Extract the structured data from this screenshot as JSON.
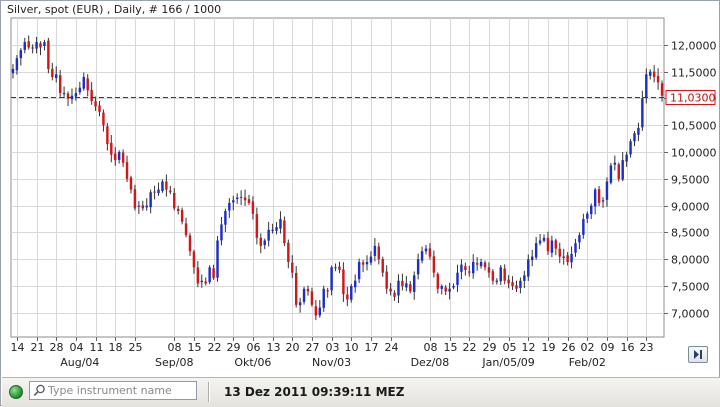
{
  "chart_title": "Silver, spot (EUR) , Daily, # 166 / 1000",
  "current_price_label": "11,0300",
  "search": {
    "placeholder": "Type instrument name"
  },
  "status": {
    "datetime": "13 Dez 2011 09:39:11 MEZ"
  },
  "colors": {
    "up": "#1a2fc8",
    "down": "#d01818",
    "reference_line": "#1a2fc8",
    "grid": "#d9d9d9",
    "price_box": "#d01818"
  },
  "chart_data": {
    "type": "candlestick",
    "y_axis": {
      "ticks": [
        7.0,
        7.5,
        8.0,
        8.5,
        9.0,
        9.5,
        10.0,
        10.5,
        11.0,
        11.5,
        12.0
      ],
      "tick_labels": [
        "7,0000",
        "7,5000",
        "8,0000",
        "8,5000",
        "9,0000",
        "9,5000",
        "10,0000",
        "10,5000",
        "11,0000",
        "11,5000",
        "12,0000"
      ],
      "range": [
        6.55,
        12.5
      ]
    },
    "x_axis": {
      "day_labels": [
        "14",
        "21",
        "28",
        "04",
        "11",
        "18",
        "25",
        "08",
        "15",
        "22",
        "29",
        "06",
        "13",
        "20",
        "27",
        "03",
        "10",
        "17",
        "24",
        "08",
        "15",
        "22",
        "29",
        "05",
        "12",
        "19",
        "26",
        "02",
        "09",
        "16",
        "23"
      ],
      "month_labels": [
        "Aug/04",
        "Sep/08",
        "Okt/06",
        "Nov/03",
        "Dez/08",
        "Jan/05/09",
        "Feb/02"
      ],
      "day_label_index": [
        1,
        6,
        11,
        16,
        21,
        26,
        31,
        41,
        46,
        51,
        56,
        61,
        66,
        71,
        76,
        81,
        86,
        91,
        96,
        106,
        111,
        116,
        121,
        126,
        131,
        136,
        141,
        146,
        151,
        156,
        161
      ],
      "month_label_index": [
        17,
        41,
        61,
        81,
        106,
        126,
        146
      ],
      "total_bars": 166
    },
    "reference_line": 11.03,
    "grid": true,
    "closes": [
      11.55,
      11.75,
      11.9,
      12.05,
      11.95,
      11.95,
      12.05,
      11.95,
      12.05,
      11.55,
      11.4,
      11.45,
      11.1,
      11.1,
      11.0,
      11.05,
      11.1,
      11.2,
      11.4,
      11.15,
      10.95,
      10.85,
      10.75,
      10.5,
      10.15,
      9.95,
      9.85,
      10.0,
      9.8,
      9.5,
      9.3,
      8.95,
      9.0,
      8.95,
      9.0,
      9.25,
      9.25,
      9.3,
      9.45,
      9.3,
      9.25,
      8.95,
      8.9,
      8.7,
      8.45,
      8.15,
      7.85,
      7.55,
      7.6,
      7.55,
      7.85,
      7.65,
      8.35,
      8.65,
      8.9,
      9.05,
      9.1,
      9.15,
      9.15,
      9.1,
      9.05,
      8.85,
      8.4,
      8.25,
      8.35,
      8.55,
      8.55,
      8.6,
      8.75,
      8.3,
      7.95,
      7.75,
      7.15,
      7.2,
      7.45,
      7.4,
      7.15,
      6.95,
      7.1,
      7.45,
      7.4,
      7.85,
      7.85,
      7.8,
      7.35,
      7.25,
      7.5,
      7.6,
      7.95,
      7.9,
      7.95,
      8.05,
      8.25,
      8.0,
      7.75,
      7.45,
      7.4,
      7.3,
      7.6,
      7.5,
      7.55,
      7.4,
      7.7,
      8.0,
      8.15,
      8.2,
      8.05,
      7.75,
      7.45,
      7.5,
      7.4,
      7.45,
      7.5,
      7.75,
      7.9,
      7.8,
      7.75,
      7.95,
      7.9,
      7.95,
      7.85,
      7.75,
      7.6,
      7.6,
      7.85,
      7.6,
      7.55,
      7.5,
      7.45,
      7.6,
      7.7,
      8.0,
      8.05,
      8.3,
      8.35,
      8.4,
      8.15,
      8.35,
      8.2,
      8.05,
      8.05,
      7.95,
      8.1,
      8.3,
      8.45,
      8.75,
      8.85,
      9.0,
      9.3,
      9.05,
      9.1,
      9.45,
      9.75,
      9.8,
      9.5,
      9.85,
      9.95,
      10.2,
      10.35,
      10.45,
      11.0,
      11.45,
      11.5,
      11.4,
      11.3,
      11.05
    ]
  }
}
